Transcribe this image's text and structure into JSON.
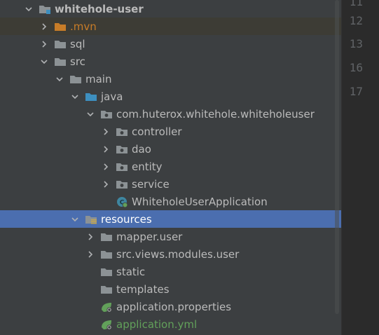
{
  "project_tree": {
    "rows": [
      {
        "label": "whitehole-user",
        "depth": 0,
        "arrow": "down",
        "icon": "module-folder-icon",
        "style": "bold"
      },
      {
        "label": ".mvn",
        "depth": 1,
        "arrow": "right",
        "icon": "folder-orange-icon",
        "style": "mvn",
        "highlight": true
      },
      {
        "label": "sql",
        "depth": 1,
        "arrow": "right",
        "icon": "folder-icon"
      },
      {
        "label": "src",
        "depth": 1,
        "arrow": "down",
        "icon": "folder-icon"
      },
      {
        "label": "main",
        "depth": 2,
        "arrow": "down",
        "icon": "folder-icon"
      },
      {
        "label": "java",
        "depth": 3,
        "arrow": "down",
        "icon": "source-folder-icon"
      },
      {
        "label": "com.huterox.whitehole.whiteholeuser",
        "depth": 4,
        "arrow": "down",
        "icon": "package-icon"
      },
      {
        "label": "controller",
        "depth": 5,
        "arrow": "right",
        "icon": "package-icon"
      },
      {
        "label": "dao",
        "depth": 5,
        "arrow": "right",
        "icon": "package-icon"
      },
      {
        "label": "entity",
        "depth": 5,
        "arrow": "right",
        "icon": "package-icon"
      },
      {
        "label": "service",
        "depth": 5,
        "arrow": "right",
        "icon": "package-icon"
      },
      {
        "label": "WhiteholeUserApplication",
        "depth": 5,
        "arrow": "none",
        "icon": "spring-class-icon"
      },
      {
        "label": "resources",
        "depth": 3,
        "arrow": "down",
        "icon": "resources-folder-icon",
        "selected": true
      },
      {
        "label": "mapper.user",
        "depth": 4,
        "arrow": "right",
        "icon": "folder-icon"
      },
      {
        "label": "src.views.modules.user",
        "depth": 4,
        "arrow": "right",
        "icon": "folder-icon"
      },
      {
        "label": "static",
        "depth": 4,
        "arrow": "none",
        "icon": "folder-icon"
      },
      {
        "label": "templates",
        "depth": 4,
        "arrow": "none",
        "icon": "folder-icon"
      },
      {
        "label": "application.properties",
        "depth": 4,
        "arrow": "none",
        "icon": "spring-config-icon"
      },
      {
        "label": "application.yml",
        "depth": 4,
        "arrow": "none",
        "icon": "spring-config-icon",
        "style": "green"
      }
    ]
  },
  "editor_gutter": {
    "line_numbers": [
      "11",
      "12",
      "13",
      "16",
      "17"
    ]
  },
  "colors": {
    "tree_bg": "#3c3f41",
    "selection": "#4b6eaf",
    "highlight": "#3d3c35",
    "folder": "#8c9295",
    "mvn": "#c77c28",
    "green": "#62a05a",
    "source_folder": "#3d8fbf"
  }
}
